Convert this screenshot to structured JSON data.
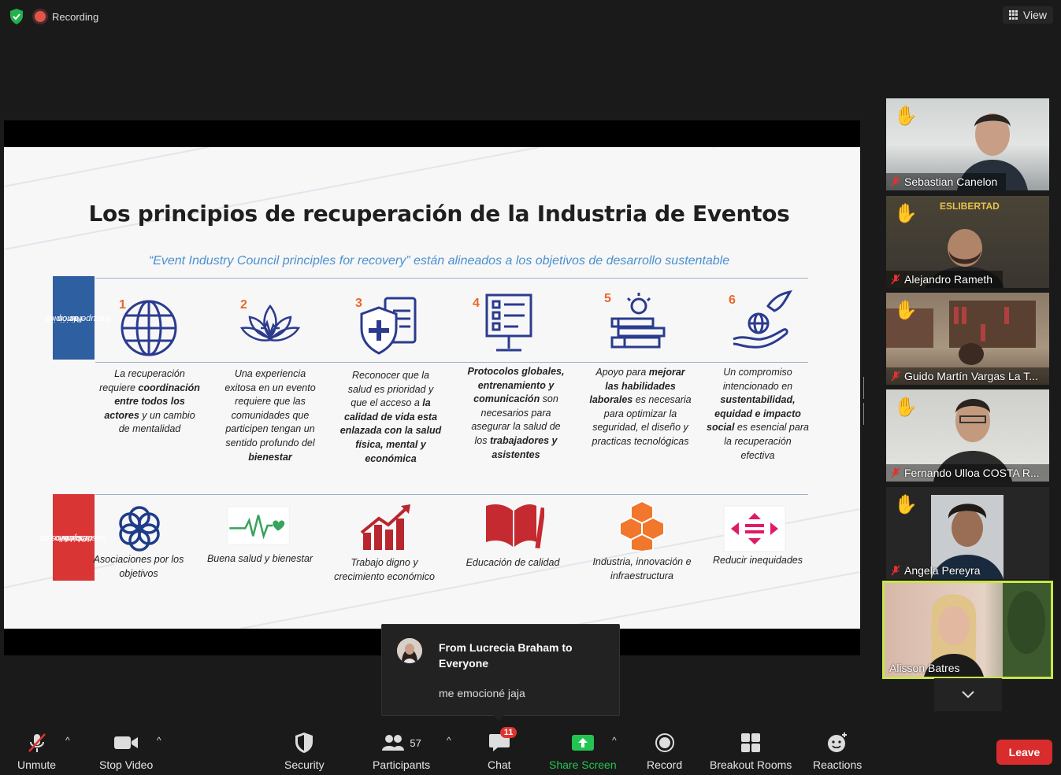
{
  "topbar": {
    "recording_label": "Recording",
    "view_label": "View"
  },
  "slide": {
    "title": "Los principios de recuperación de la Industria de Eventos",
    "subtitle": "“Event Industry Council principles for recovery” están alineados a los objetivos de desarrollo sustentable",
    "side_principles": "Principios de Recuperación",
    "side_principles_lines": [
      "Principios",
      "de",
      "Recuperación"
    ],
    "side_sdg_lines": [
      "Objetivos de",
      "desarrollo",
      "Sustentable"
    ],
    "principles": [
      {
        "num": "1",
        "icon": "globe-icon",
        "text_html": "La recuperación requiere <b>coordinación entre todos los actores</b> y un cambio de mentalidad"
      },
      {
        "num": "2",
        "icon": "lotus-icon",
        "text_html": "Una experiencia exitosa en un evento requiere que las comunidades que participen tengan un sentido profundo del <b>bienestar</b>"
      },
      {
        "num": "3",
        "icon": "health-shield-icon",
        "text_html": "Reconocer que la salud es prioridad y que el acceso a <b>la calidad de vida esta enlazada con la salud física, mental y económica</b>"
      },
      {
        "num": "4",
        "icon": "checklist-board-icon",
        "text_html": "<b>Protocolos globales, entrenamiento y comunicación</b> son necesarios para asegurar la salud de los <b>trabajadores y asistentes</b>"
      },
      {
        "num": "5",
        "icon": "books-idea-icon",
        "text_html": "Apoyo para <b>mejorar las habilidades laborales</b> es necesaria para optimizar la seguridad, el diseño y practicas tecnológicas"
      },
      {
        "num": "6",
        "icon": "hand-globe-dove-icon",
        "text_html": "Un compromiso intencionado en <b>sustentabilidad, equidad e impacto social</b> es esencial para la recuperación efectiva"
      }
    ],
    "sdgs": [
      {
        "icon": "partnership-icon",
        "label": "Asociaciones por los objetivos"
      },
      {
        "icon": "heartbeat-icon",
        "label": "Buena salud y bienestar"
      },
      {
        "icon": "growth-chart-icon",
        "label": "Trabajo digno y crecimiento económico"
      },
      {
        "icon": "book-icon",
        "label": "Educación de calidad"
      },
      {
        "icon": "cubes-icon",
        "label": "Industria, innovación e infraestructura"
      },
      {
        "icon": "equality-icon",
        "label": "Reducir inequidades"
      }
    ]
  },
  "participants": [
    {
      "name": "Sebastian Canelon",
      "hand_raised": true,
      "muted": true
    },
    {
      "name": "Alejandro Rameth",
      "hand_raised": true,
      "muted": true,
      "overlay_text": "ESLIBERTAD"
    },
    {
      "name": "Guido Martín Vargas La T...",
      "hand_raised": true,
      "muted": true
    },
    {
      "name": "Fernando Ulloa  COSTA R...",
      "hand_raised": true,
      "muted": true
    },
    {
      "name": "Angela Pereyra",
      "hand_raised": true,
      "muted": true
    },
    {
      "name": "Alisson Batres",
      "hand_raised": false,
      "muted": false,
      "active_speaker": true
    }
  ],
  "chat_popup": {
    "from": "From Lucrecia Braham to Everyone",
    "message": "me emocioné jaja"
  },
  "toolbar": {
    "unmute": "Unmute",
    "stop_video": "Stop Video",
    "security": "Security",
    "participants": "Participants",
    "participants_count": "57",
    "chat": "Chat",
    "chat_badge": "11",
    "share_screen": "Share Screen",
    "record": "Record",
    "breakout_rooms": "Breakout Rooms",
    "reactions": "Reactions",
    "leave": "Leave"
  },
  "colors": {
    "background": "#1a1a1a",
    "leave": "#d92c2c",
    "share_green": "#23c552",
    "active_speaker_border": "#c6e64a",
    "slide_blue": "#2e5fa0",
    "slide_red": "#d93535",
    "accent_orange": "#e8672a"
  }
}
